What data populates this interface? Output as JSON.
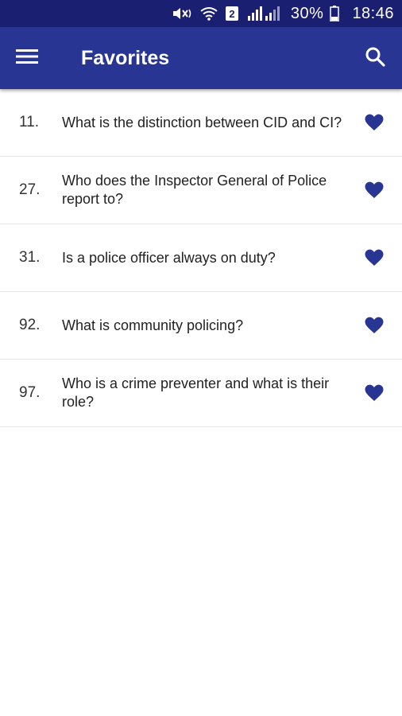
{
  "status_bar": {
    "battery_percent": "30%",
    "time": "18:46",
    "sim_badge": "2",
    "background": "#1a1f72"
  },
  "app_bar": {
    "title": "Favorites",
    "background": "#283593",
    "menu_icon": "menu-icon",
    "search_icon": "search-icon"
  },
  "favorites": [
    {
      "number": "11.",
      "question": "What is the distinction between CID and CI?",
      "favorited": true
    },
    {
      "number": "27.",
      "question": "Who does the Inspector General of Police report to?",
      "favorited": true
    },
    {
      "number": "31.",
      "question": "Is a police officer always on duty?",
      "favorited": true
    },
    {
      "number": "92.",
      "question": "What is community policing?",
      "favorited": true
    },
    {
      "number": "97.",
      "question": "Who is a crime preventer and what is their role?",
      "favorited": true
    }
  ],
  "colors": {
    "heart": "#283593",
    "divider": "#e6e6e6"
  }
}
